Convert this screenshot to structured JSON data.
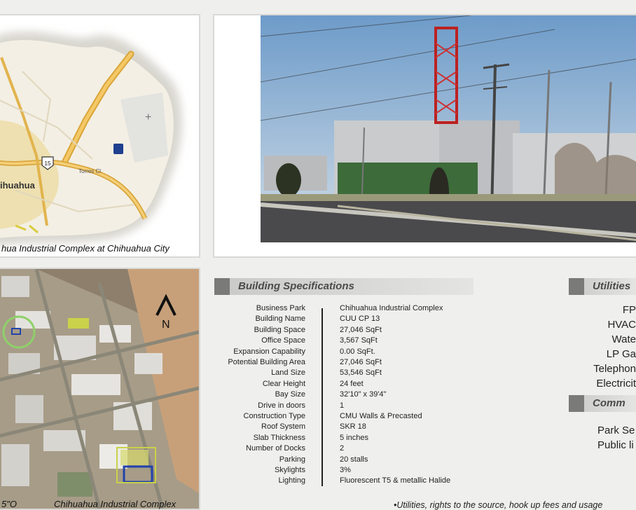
{
  "map": {
    "caption": "hua Industrial Complex at Chihuahua City",
    "city_label": "ihuahua",
    "highway_marker": "15",
    "road_label": "Torres Cl"
  },
  "aerial": {
    "caption_left": "5\"O",
    "caption_right": "Chihuahua Industrial Complex",
    "north_label": "N"
  },
  "building_specs": {
    "title": "Building Specifications",
    "rows": [
      {
        "label": "Business Park",
        "value": "Chihuahua Industrial Complex"
      },
      {
        "label": "Building Name",
        "value": "CUU CP 13"
      },
      {
        "label": "Building Space",
        "value": "27,046 SqFt"
      },
      {
        "label": "Office Space",
        "value": "3,567 SqFt"
      },
      {
        "label": "Expansion Capability",
        "value": "0.00 SqFt."
      },
      {
        "label": "Potential Building Area",
        "value": "27,046 SqFt"
      },
      {
        "label": "Land Size",
        "value": "53,546 SqFt"
      },
      {
        "label": "Clear Height",
        "value": "24 feet"
      },
      {
        "label": "Bay Size",
        "value": "32'10\" x 39'4\""
      },
      {
        "label": "Drive in doors",
        "value": "1"
      },
      {
        "label": "Construction Type",
        "value": "CMU  Walls & Precasted"
      },
      {
        "label": "Roof System",
        "value": "SKR 18"
      },
      {
        "label": "Slab Thickness",
        "value": "5 inches"
      },
      {
        "label": "Number of Docks",
        "value": "2"
      },
      {
        "label": "Parking",
        "value": "20 stalls"
      },
      {
        "label": "Skylights",
        "value": "3%"
      },
      {
        "label": "Lighting",
        "value": "Fluorescent T5 & metallic Halide"
      }
    ]
  },
  "utilities": {
    "title": "Utilities",
    "items": [
      "FP",
      "HVAC",
      "Wate",
      "LP Ga",
      "Telephon",
      "Electricit"
    ]
  },
  "comm": {
    "title": "Comm",
    "items": [
      "Park Se",
      "Public li"
    ]
  },
  "footnote": "•Utilities, rights to the source, hook up fees and usage"
}
